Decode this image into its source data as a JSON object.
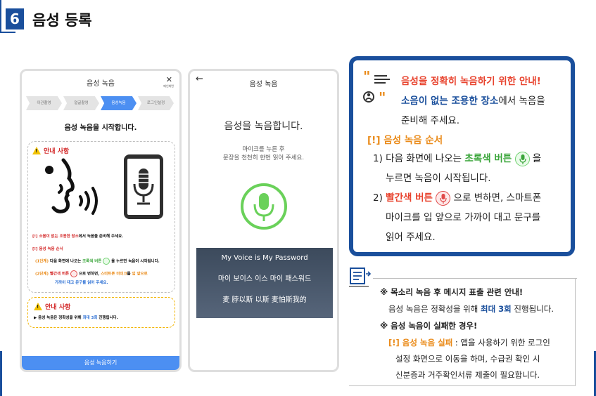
{
  "header": {
    "step": "6",
    "title": "음성 등록"
  },
  "phone1": {
    "title": "음성 녹음",
    "close_sub": "메인화면",
    "tabs": [
      "이관촬영",
      "얼굴촬영",
      "음성녹음",
      "로그인설정"
    ],
    "heading": "음성 녹음을 시작합니다.",
    "notice_title": "안내 사항",
    "line1_a": "[!] 소음이 없는 조용한 장소",
    "line1_b": "에서 녹음을 준비해 주세요.",
    "line2": "[!] 음성 녹음 순서",
    "line3_a": "(1단계)",
    "line3_b": " 다음 화면에 나오는 ",
    "line3_c": "초록색 버튼",
    "line3_d": " 을 누르면 녹음이 시작됩니다.",
    "line4_a": "(2단계)",
    "line4_b": " 빨간색 버튼",
    "line4_c": " 으로 변하면, ",
    "line4_d": "스마트폰 마이크",
    "line4_e": "를 ",
    "line4_f": "입 앞으로",
    "line5_a": "가까이 대고 ",
    "line5_b": "문구를 읽어 주세요.",
    "notice2_title": "안내 사항",
    "notice2_a": "▶ 음성 녹음은 정확성을 위해 ",
    "notice2_b": "최대 3회",
    "notice2_c": " 진행됩니다.",
    "button": "음성 녹음하기"
  },
  "phone2": {
    "back": "←",
    "title": "음성 녹음",
    "heading": "음성을 녹음합니다.",
    "sub1": "마이크를 누른 후",
    "sub2": "문장을 천천히 한번 읽어 주세요.",
    "phrases": [
      "My Voice is My Password",
      "마이 보이스 이스 마이 패스워드",
      "麦 脖以斯 以斯 麦怕斯我的"
    ]
  },
  "guide": {
    "title": "음성을 정확히 녹음하기 위한 안내!",
    "l1_a": "소음이 없는 조용한 장소",
    "l1_b": "에서 녹음을",
    "l2": "준비해 주세요.",
    "l3": "[!] 음성 녹음 순서",
    "l4_a": "1) 다음 화면에 나오는 ",
    "l4_b": "초록색 버튼",
    "l4_c": " 을",
    "l5": "누르면 녹음이 시작됩니다.",
    "l6_a": "2) ",
    "l6_b": "빨간색 버튼",
    "l6_c": " 으로  변하면, 스마트폰",
    "l7": "마이크를 입 앞으로 가까이 대고 문구를",
    "l8": "읽어 주세요."
  },
  "info": {
    "l1": "※ 목소리 녹음 후 메시지 표출 관련 안내!",
    "l2_a": "음성 녹음은 정확성을 위해 ",
    "l2_b": "최대 3회",
    "l2_c": " 진행됩니다.",
    "l3": "※ 음성 녹음이 실패한 경우!",
    "l4_a": "[!] 음성 녹음 실패",
    "l4_b": " : 앱을 사용하기 위한 로그인",
    "l5": "설정 화면으로 이동을 하며, 수급권 확인 시",
    "l6": "신분증과 거주확인서류 제출이 필요합니다."
  },
  "colors": {
    "brand": "#1a4f9c",
    "accent_red": "#e8432e",
    "accent_green": "#3aa53a",
    "accent_orange": "#ea8b1a",
    "button_blue": "#4c8ff2"
  }
}
